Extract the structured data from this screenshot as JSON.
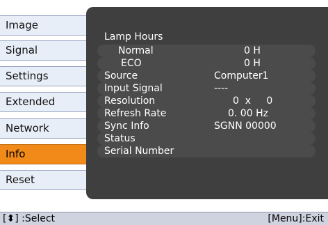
{
  "menu": {
    "items": [
      {
        "label": "Image"
      },
      {
        "label": "Signal"
      },
      {
        "label": "Settings"
      },
      {
        "label": "Extended"
      },
      {
        "label": "Network"
      },
      {
        "label": "Info",
        "active": true
      },
      {
        "label": "Reset"
      }
    ]
  },
  "info": {
    "lamp_hours_label": "Lamp Hours",
    "normal_label": "Normal",
    "normal_value": "0 H",
    "eco_label": "ECO",
    "eco_value": "0 H",
    "source_label": "Source",
    "source_value": "Computer1",
    "input_signal_label": "Input Signal",
    "input_signal_value": "----",
    "resolution_label": "Resolution",
    "resolution_value": "0  x     0",
    "refresh_rate_label": "Refresh Rate",
    "refresh_rate_value": "0. 00 Hz",
    "sync_info_label": "Sync Info",
    "sync_info_value": "SGNN 00000",
    "status_label": "Status",
    "serial_number_label": "Serial Number"
  },
  "footer": {
    "select_hint": "[⬍] :Select",
    "exit_hint": "[Menu]:Exit"
  },
  "colors": {
    "panel": "#3f3f3f",
    "active_tab": "#f28a1a",
    "tab": "#e8eef8",
    "footer": "#cfd3df"
  }
}
